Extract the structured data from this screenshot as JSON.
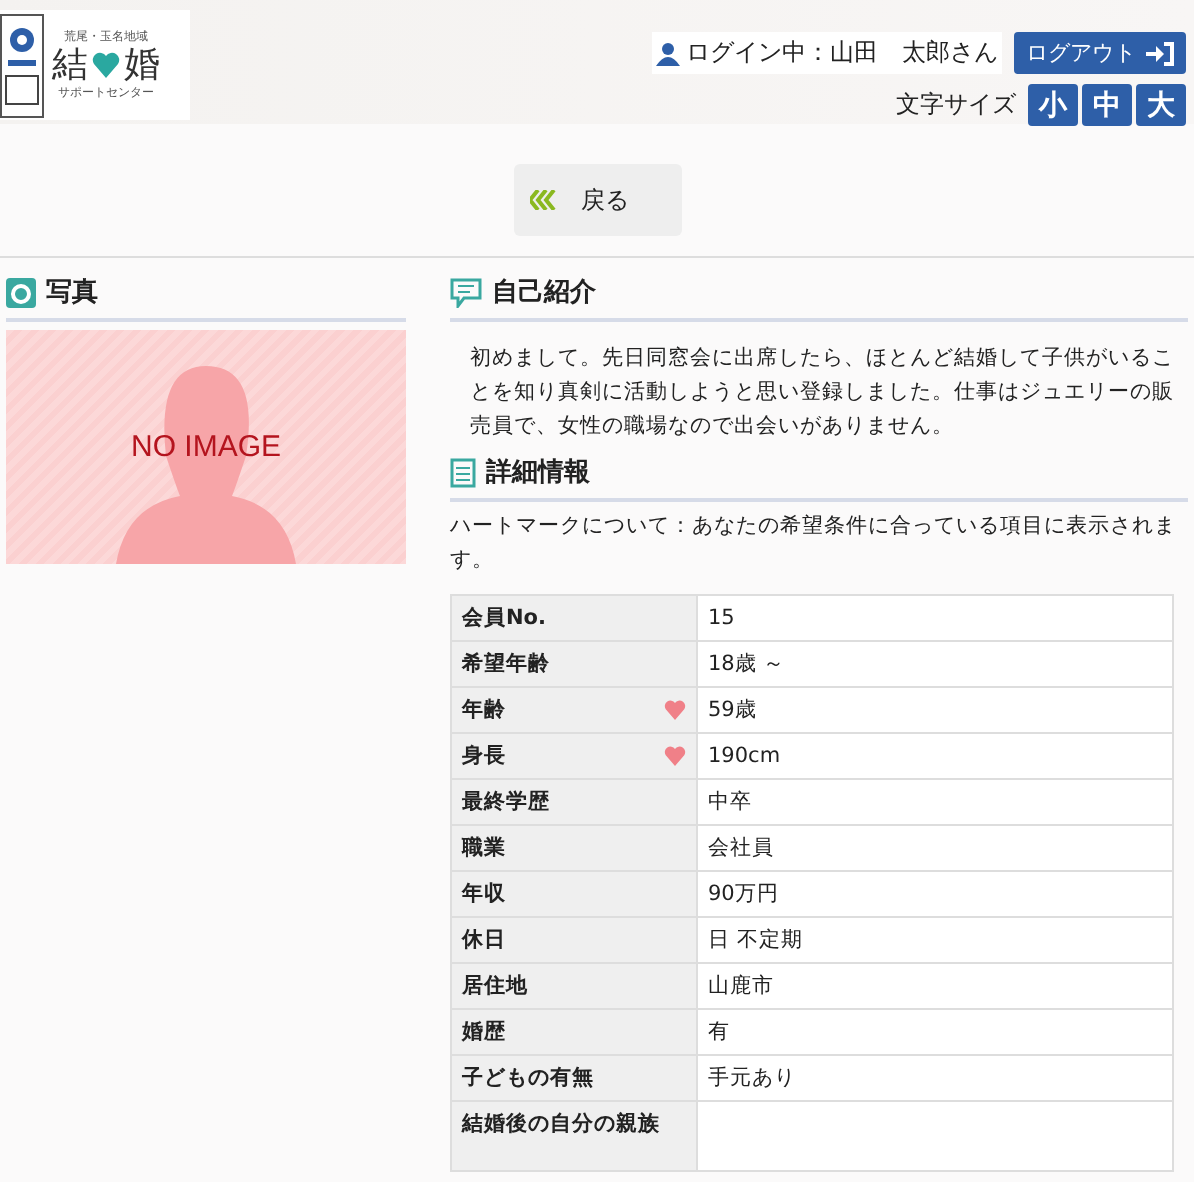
{
  "logo": {
    "region": "荒尾・玉名地域",
    "name_left": "結",
    "name_right": "婚",
    "subtitle": "サポートセンター"
  },
  "login": {
    "status": "ログイン中：山田　太郎さん",
    "logout": "ログアウト"
  },
  "font_size": {
    "label": "文字サイズ",
    "options": [
      "小",
      "中",
      "大"
    ]
  },
  "back_button": "戻る",
  "photo": {
    "heading": "写真",
    "placeholder": "NO IMAGE"
  },
  "intro": {
    "heading": "自己紹介",
    "text": "初めまして。先日同窓会に出席したら、ほとんど結婚して子供がいることを知り真剣に活動しようと思い登録しました。仕事はジュエリーの販売員で、女性の職場なので出会いがありません。"
  },
  "details": {
    "heading": "詳細情報",
    "note": "ハートマークについて：あなたの希望条件に合っている項目に表示されます。",
    "rows": [
      {
        "label": "会員No.",
        "value": "15",
        "match": false
      },
      {
        "label": "希望年齢",
        "value": "18歳 ～",
        "match": false
      },
      {
        "label": "年齢",
        "value": "59歳",
        "match": true
      },
      {
        "label": "身長",
        "value": "190cm",
        "match": true
      },
      {
        "label": "最終学歴",
        "value": "中卒",
        "match": false
      },
      {
        "label": "職業",
        "value": "会社員",
        "match": false
      },
      {
        "label": "年収",
        "value": "90万円",
        "match": false
      },
      {
        "label": "休日",
        "value": "日 不定期",
        "match": false
      },
      {
        "label": "居住地",
        "value": "山鹿市",
        "match": false
      },
      {
        "label": "婚歴",
        "value": "有",
        "match": false
      },
      {
        "label": "子どもの有無",
        "value": "手元あり",
        "match": false
      },
      {
        "label": "結婚後の自分の親族",
        "value": "",
        "match": false
      }
    ]
  }
}
